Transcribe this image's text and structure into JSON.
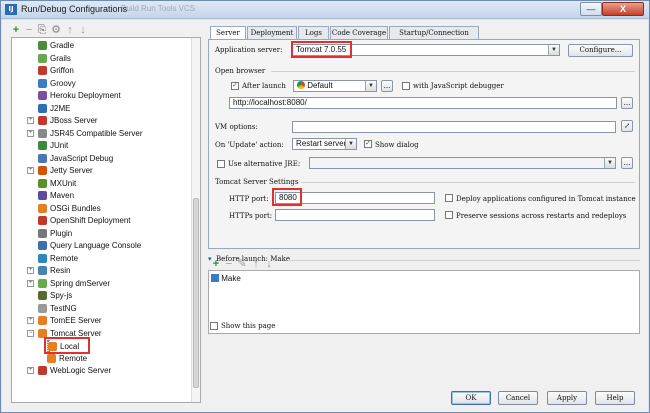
{
  "window": {
    "title": "Run/Debug Configurations",
    "app_icon_text": "IJ",
    "min_glyph": "—",
    "close_glyph": "X",
    "ghost_menu": "Build  Run  Tools  VCS"
  },
  "left_toolbar": [
    "+",
    "−",
    "⎘",
    "⚙",
    "↑",
    "↓"
  ],
  "tree": {
    "items": [
      {
        "label": "Gradle",
        "color": "#4a8c3a"
      },
      {
        "label": "Grails",
        "color": "#6aa84f"
      },
      {
        "label": "Griffon",
        "color": "#c0392b"
      },
      {
        "label": "Groovy",
        "color": "#3b7bbf"
      },
      {
        "label": "Heroku Deployment",
        "color": "#7b4fa0"
      },
      {
        "label": "J2ME",
        "color": "#2c6fb7"
      },
      {
        "label": "JBoss Server",
        "color": "#c0392b"
      },
      {
        "label": "JSR45 Compatible Server",
        "color": "#888888"
      },
      {
        "label": "JUnit",
        "color": "#3b8a3b"
      },
      {
        "label": "JavaScript Debug",
        "color": "#4a78b5"
      },
      {
        "label": "Jetty Server",
        "color": "#d35400"
      },
      {
        "label": "MXUnit",
        "color": "#5a8f29"
      },
      {
        "label": "Maven",
        "color": "#5b4a9e"
      },
      {
        "label": "OSGi Bundles",
        "color": "#e67e22"
      },
      {
        "label": "OpenShift Deployment",
        "color": "#c0392b"
      },
      {
        "label": "Plugin",
        "color": "#777777"
      },
      {
        "label": "Query Language Console",
        "color": "#3b6fb0"
      },
      {
        "label": "Remote",
        "color": "#2e86c1"
      },
      {
        "label": "Resin",
        "color": "#4682b4"
      },
      {
        "label": "Spring dmServer",
        "color": "#6aa84f"
      },
      {
        "label": "Spy-js",
        "color": "#556b2f"
      },
      {
        "label": "TestNG",
        "color": "#999999"
      },
      {
        "label": "TomEE Server",
        "color": "#e67e22"
      },
      {
        "label": "Tomcat Server",
        "color": "#e67e22"
      },
      {
        "label": "Local",
        "color": "#e67e22"
      },
      {
        "label": "Remote",
        "color": "#e67e22"
      },
      {
        "label": "WebLogic Server",
        "color": "#c0392b"
      }
    ]
  },
  "tabs": [
    "Server",
    "Deployment",
    "Logs",
    "Code Coverage",
    "Startup/Connection"
  ],
  "server": {
    "app_server_label": "Application server:",
    "app_server_value": "Tomcat 7.0.55",
    "configure_label": "Configure...",
    "open_browser_label": "Open browser",
    "after_launch_label": "After launch",
    "browser_value": "Default",
    "ellipsis_label": "...",
    "js_debugger_label": "with JavaScript debugger",
    "url_value": "http://localhost:8080/",
    "vm_options_label": "VM options:",
    "on_update_label": "On 'Update' action:",
    "on_update_value": "Restart server",
    "show_dialog_label": "Show dialog",
    "use_jre_label": "Use alternative JRE:",
    "tomcat_settings_label": "Tomcat Server Settings",
    "http_port_label": "HTTP port:",
    "http_port_value": "8080",
    "https_port_label": "HTTPs port:",
    "deploy_label": "Deploy applications configured in Tomcat instance",
    "preserve_label": "Preserve sessions across restarts and redeploys"
  },
  "before_launch": {
    "label": "Before launch: Make",
    "toolbar": [
      "+",
      "−",
      "✎",
      "↑",
      "↓"
    ],
    "items": [
      "Make"
    ],
    "show_page_label": "Show this page"
  },
  "buttons": {
    "ok": "OK",
    "cancel": "Cancel",
    "apply": "Apply",
    "help": "Help"
  },
  "colors": {
    "highlight": "#e03030",
    "selection": "#cfe2f7"
  }
}
